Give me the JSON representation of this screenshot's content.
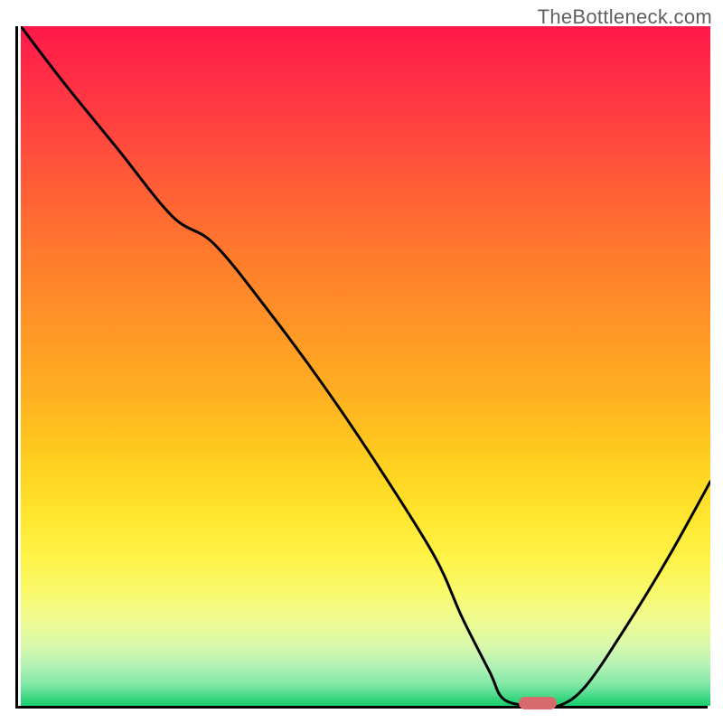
{
  "watermark": "TheBottleneck.com",
  "chart_data": {
    "type": "line",
    "title": "",
    "xlabel": "",
    "ylabel": "",
    "xlim": [
      0,
      100
    ],
    "ylim": [
      0,
      100
    ],
    "x": [
      0,
      6,
      14,
      22,
      28,
      36,
      44,
      52,
      60,
      64,
      68,
      70,
      74,
      78,
      82,
      88,
      94,
      100
    ],
    "values": [
      100,
      92,
      82,
      72,
      68,
      58,
      47,
      35,
      22,
      13,
      5,
      1,
      0,
      0,
      3,
      12,
      22,
      33
    ],
    "marker": {
      "x": 75,
      "y": 0
    },
    "gradient_colors": {
      "top": "#ff1849",
      "mid": "#ffd522",
      "bottom": "#1bd06f"
    }
  }
}
